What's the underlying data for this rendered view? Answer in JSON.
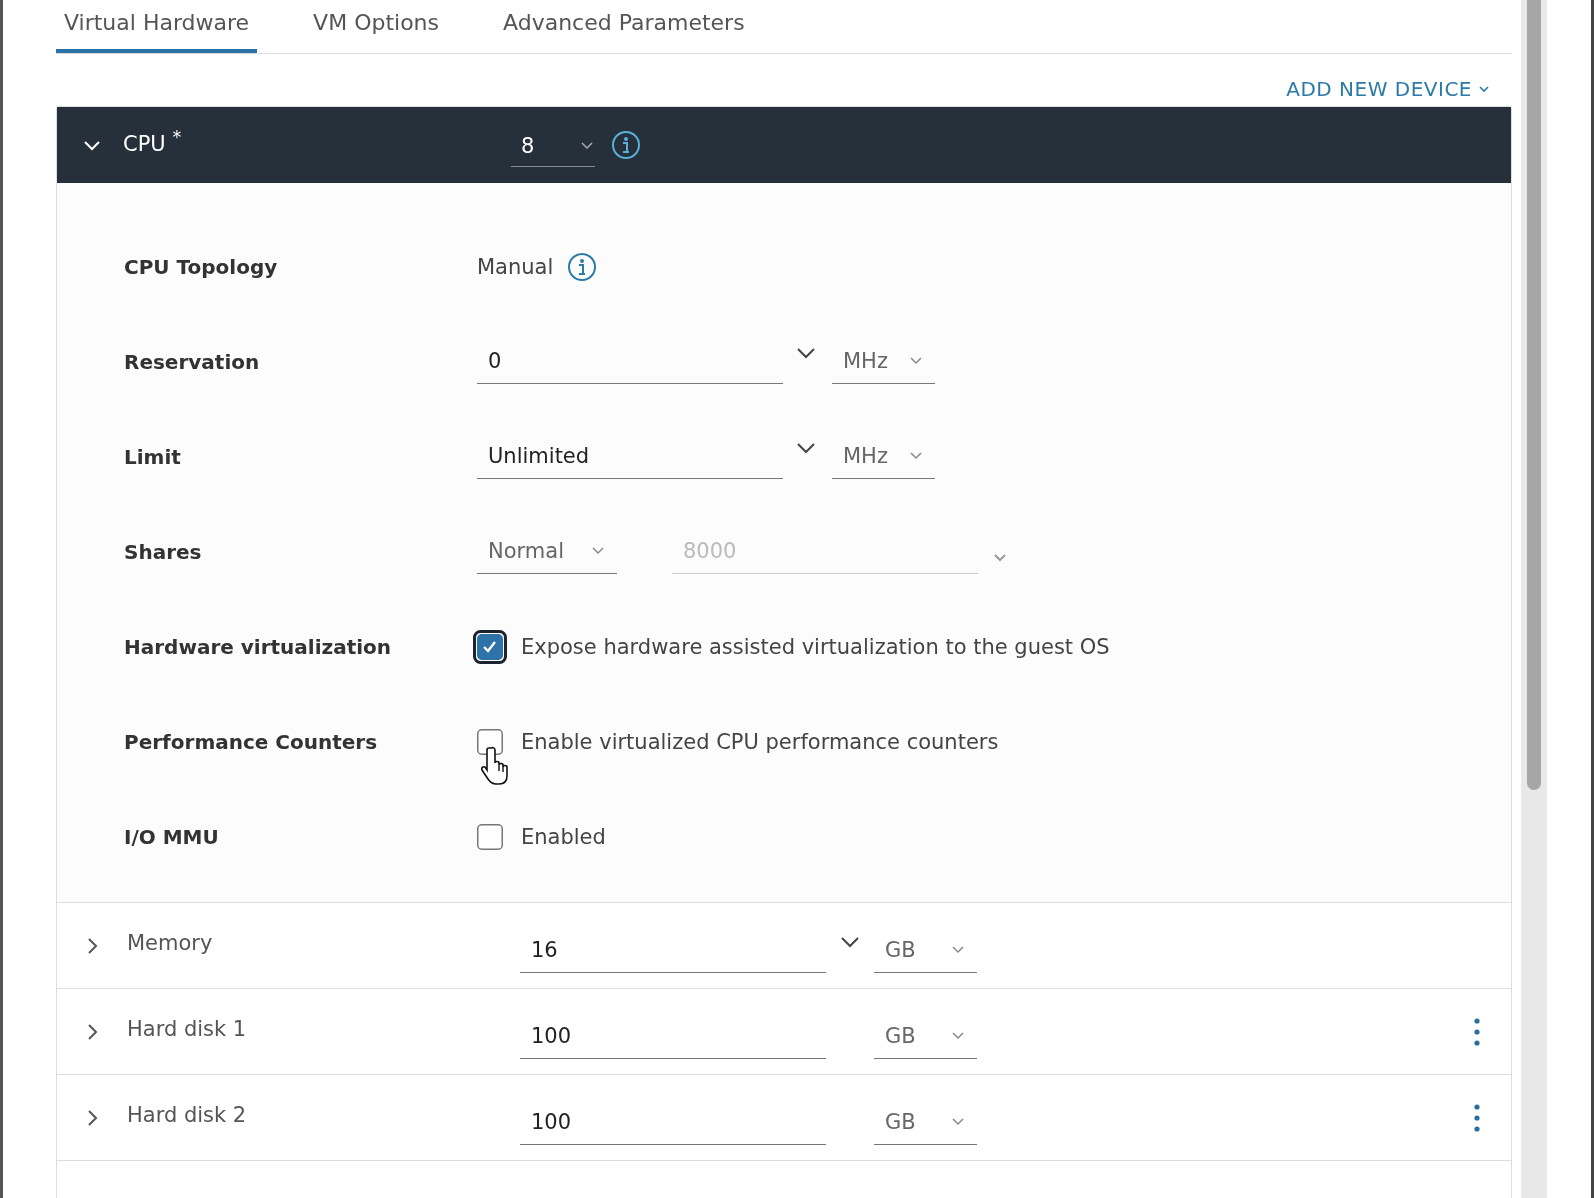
{
  "tabs": [
    {
      "label": "Virtual Hardware",
      "selected": true
    },
    {
      "label": "VM Options",
      "selected": false
    },
    {
      "label": "Advanced Parameters",
      "selected": false
    }
  ],
  "add_device": {
    "label": "ADD NEW DEVICE"
  },
  "cpu": {
    "label": "CPU $^{*}$",
    "expanded": true,
    "value": "8",
    "settings": [
      {
        "kind": "text",
        "label": "CPU Topology",
        "value": "Manual"
      },
      {
        "kind": "combo",
        "label": "Reservation",
        "value": "0",
        "unit": "MHz"
      },
      {
        "kind": "combo",
        "label": "Limit",
        "value": "Unlimited",
        "unit": "MHz"
      },
      {
        "kind": "shares",
        "label": "Shares",
        "choice": "Normal",
        "value": "8000",
        "disabled": true
      },
      {
        "kind": "checkbox",
        "label": "Hardware virtualization",
        "text": "Expose hardware assisted virtualization to the guest OS",
        "checked": true,
        "focused": true
      },
      {
        "kind": "checkbox",
        "label": "Performance Counters",
        "text": "Enable virtualized CPU performance counters",
        "checked": false,
        "focused": false,
        "pointer": true
      },
      {
        "kind": "checkbox",
        "label": "I/O MMU",
        "text": "Enabled",
        "checked": false,
        "focused": false
      }
    ]
  },
  "devices": [
    {
      "label": "Memory",
      "expanded": false,
      "value": "16",
      "unit": "GB",
      "dropdown": true,
      "menu": false
    },
    {
      "label": "Hard disk 1",
      "expanded": false,
      "value": "100",
      "unit": "GB",
      "dropdown": false,
      "menu": true
    },
    {
      "label": "Hard disk 2",
      "expanded": false,
      "value": "100",
      "unit": "GB",
      "dropdown": false,
      "menu": true
    }
  ]
}
